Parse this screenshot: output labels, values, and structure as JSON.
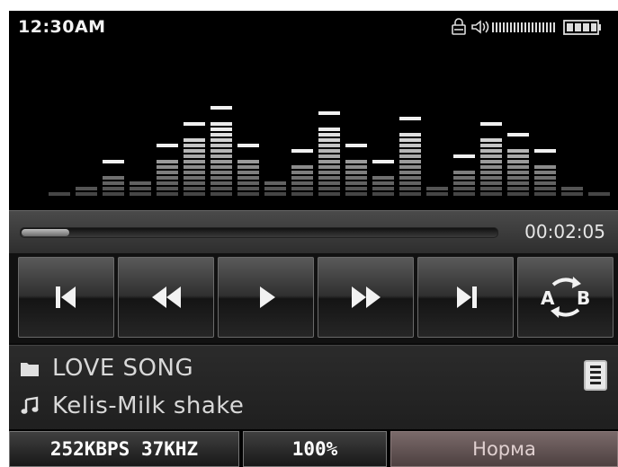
{
  "status_bar": {
    "time": "12:30AM",
    "icons": [
      "lock-icon",
      "speaker-icon",
      "signal-bars-icon",
      "battery-icon"
    ]
  },
  "visualizer": {
    "bar_levels": [
      1,
      2,
      4,
      3,
      7,
      11,
      14,
      7,
      3,
      6,
      13,
      7,
      4,
      12,
      2,
      5,
      11,
      9,
      6,
      2,
      1
    ]
  },
  "progress": {
    "elapsed": "00:02:05",
    "fraction": 0.1
  },
  "controls": {
    "buttons": [
      "previous-track",
      "rewind",
      "play",
      "fast-forward",
      "next-track",
      "ab-repeat"
    ],
    "ab_label": "A B"
  },
  "now_playing": {
    "folder": "LOVE SONG",
    "song": "Kelis-Milk shake"
  },
  "bottom_bar": {
    "bitrate": "252KBPS 37KHZ",
    "volume": "100%",
    "mode": "Норма"
  },
  "colors": {
    "background": "#000000",
    "text": "#d8d8d8",
    "accent": "#ffffff"
  }
}
